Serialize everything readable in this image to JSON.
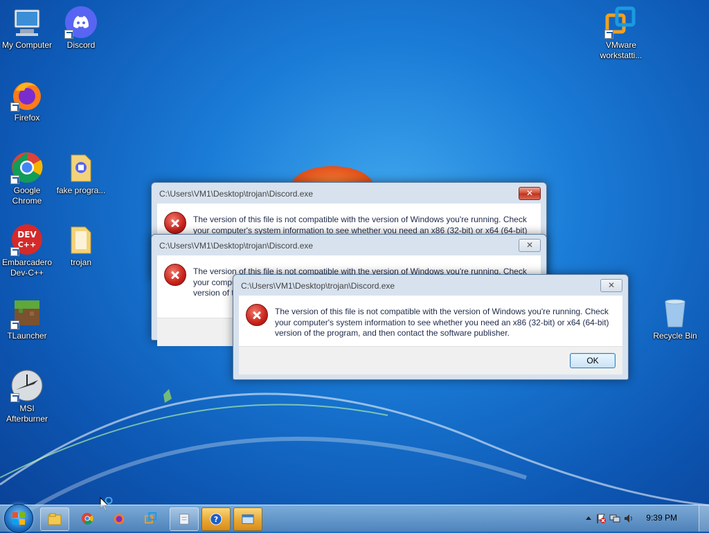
{
  "desktop": {
    "icons": [
      {
        "label": "My Computer",
        "icon": "computer-icon"
      },
      {
        "label": "Discord",
        "icon": "discord-icon"
      },
      {
        "label": "VMware workstatti...",
        "icon": "vmware-icon"
      },
      {
        "label": "Firefox",
        "icon": "firefox-icon"
      },
      {
        "label": "Google Chrome",
        "icon": "chrome-icon"
      },
      {
        "label": "fake progra...",
        "icon": "folder-icon"
      },
      {
        "label": "Embarcadero Dev-C++",
        "icon": "devcpp-icon"
      },
      {
        "label": "trojan",
        "icon": "folder-icon"
      },
      {
        "label": "TLauncher",
        "icon": "minecraft-icon"
      },
      {
        "label": "Recycle Bin",
        "icon": "recycle-bin-icon"
      },
      {
        "label": "MSI Afterburner",
        "icon": "msi-afterburner-icon"
      }
    ]
  },
  "dialogs": [
    {
      "title": "C:\\Users\\VM1\\Desktop\\trojan\\Discord.exe",
      "message": "The version of this file is not compatible with the version of Windows you're running. Check your computer's system information to see whether you need an x86 (32-bit) or x64 (64-bit) version of the program, and then contact the software publisher.",
      "close_label": "✕",
      "ok_label": "OK"
    },
    {
      "title": "C:\\Users\\VM1\\Desktop\\trojan\\Discord.exe",
      "message": "The version of this file is not compatible with the version of Windows you're running. Check your computer's system information to see whether you need an x86 (32-bit) or x64 (64-bit) version of the program, and then contact the software publisher.",
      "close_label": "✕",
      "ok_label": "OK"
    },
    {
      "title": "C:\\Users\\VM1\\Desktop\\trojan\\Discord.exe",
      "message": "The version of this file is not compatible with the version of Windows you're running. Check your computer's system information to see whether you need an x86 (32-bit) or x64 (64-bit) version of the program, and then contact the software publisher.",
      "close_label": "✕",
      "ok_label": "OK"
    }
  ],
  "taskbar": {
    "pinned": [
      "windows-explorer-icon",
      "chrome-icon",
      "firefox-icon",
      "vmware-icon"
    ],
    "windows": [
      "notepad-icon",
      "help-icon",
      "dialog-window-icon"
    ],
    "clock": "9:39 PM",
    "tray_icons": [
      "show-hidden-icons-icon",
      "action-center-flag-icon",
      "network-icon",
      "volume-icon"
    ]
  },
  "colors": {
    "desktop_blue": "#1a7bd6",
    "error_red": "#c8221a",
    "taskbar_active": "#e8a733"
  }
}
